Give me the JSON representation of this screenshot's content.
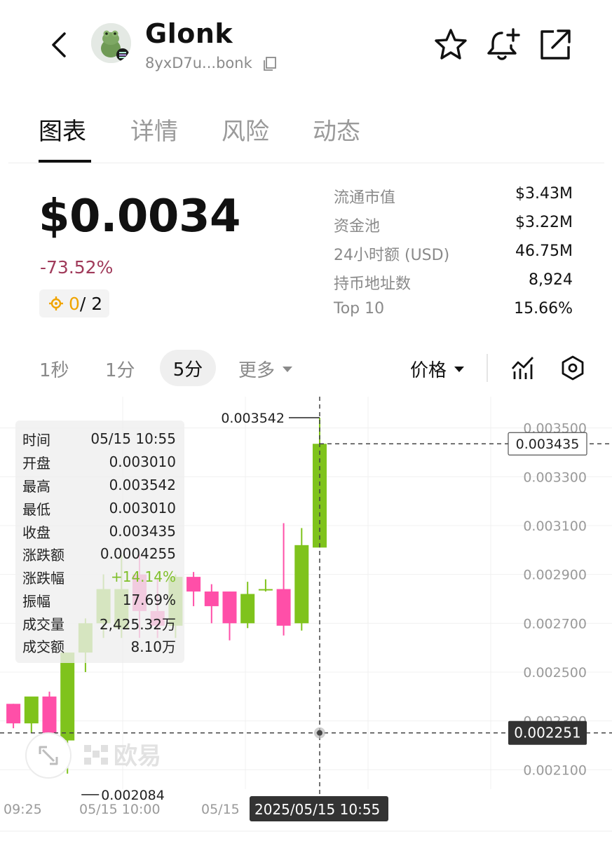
{
  "header": {
    "title": "Glonk",
    "address": "8yxD7u...bonk"
  },
  "tabs": [
    {
      "label": "图表",
      "active": true
    },
    {
      "label": "详情",
      "active": false
    },
    {
      "label": "风险",
      "active": false
    },
    {
      "label": "动态",
      "active": false
    }
  ],
  "price": {
    "value": "$0.0034",
    "change": "-73.52%",
    "score_current": "0",
    "score_rest": " / 2"
  },
  "stats": [
    {
      "label": "流通市值",
      "value": "$3.43M"
    },
    {
      "label": "资金池",
      "value": "$3.22M"
    },
    {
      "label": "24小时额 (USD)",
      "value": "46.75M"
    },
    {
      "label": "持币地址数",
      "value": "8,924"
    },
    {
      "label": "Top 10",
      "value": "15.66%"
    }
  ],
  "intervals": {
    "i1s": "1秒",
    "i1m": "1分",
    "i5m": "5分",
    "more": "更多",
    "price_mode": "价格"
  },
  "colors": {
    "up": "#7fc31c",
    "down": "#ff4fa8",
    "change_negative": "#a03a5a"
  },
  "tooltip": {
    "rows": [
      {
        "label": "时间",
        "value": "05/15 10:55"
      },
      {
        "label": "开盘",
        "value": "0.003010"
      },
      {
        "label": "最高",
        "value": "0.003542"
      },
      {
        "label": "最低",
        "value": "0.003010"
      },
      {
        "label": "收盘",
        "value": "0.003435"
      },
      {
        "label": "涨跌额",
        "value": "0.0004255"
      },
      {
        "label": "涨跌幅",
        "value": "+14.14%"
      },
      {
        "label": "振幅",
        "value": "17.69%"
      },
      {
        "label": "成交量",
        "value": "2,425.32万"
      },
      {
        "label": "成交额",
        "value": "8.10万"
      }
    ]
  },
  "chart_data": {
    "type": "candlestick",
    "y_ticks": [
      0.0021,
      0.0023,
      0.0025,
      0.0027,
      0.0029,
      0.0031,
      0.0033,
      0.0035
    ],
    "y_tick_labels": [
      "0.002100",
      "0.002300",
      "0.002500",
      "0.002700",
      "0.002900",
      "0.003100",
      "0.003300",
      "0.003500"
    ],
    "ylim": [
      0.002035,
      0.003628
    ],
    "x_tick_labels": [
      "09:25",
      "05/15 10:00",
      "05/15"
    ],
    "current_price_label": "0.003435",
    "crosshair_price_label": "0.002251",
    "crosshair_time_label": "2025/05/15 10:55",
    "high_label": "0.003542",
    "low_label": "0.002084",
    "watermark": "欧易",
    "candles": [
      {
        "o": 0.00237,
        "h": 0.00237,
        "l": 0.00227,
        "c": 0.00229
      },
      {
        "o": 0.00229,
        "h": 0.00239,
        "l": 0.00225,
        "c": 0.0024
      },
      {
        "o": 0.0024,
        "h": 0.00242,
        "l": 0.00218,
        "c": 0.00221
      },
      {
        "o": 0.00222,
        "h": 0.00247,
        "l": 0.002084,
        "c": 0.00258
      },
      {
        "o": 0.00258,
        "h": 0.00272,
        "l": 0.0025,
        "c": 0.0027
      },
      {
        "o": 0.0027,
        "h": 0.0029,
        "l": 0.00264,
        "c": 0.00284
      },
      {
        "o": 0.00268,
        "h": 0.00298,
        "l": 0.00264,
        "c": 0.00284
      },
      {
        "o": 0.0029,
        "h": 0.00298,
        "l": 0.00264,
        "c": 0.00275
      },
      {
        "o": 0.00275,
        "h": 0.00288,
        "l": 0.00264,
        "c": 0.00269
      },
      {
        "o": 0.00269,
        "h": 0.0029,
        "l": 0.00264,
        "c": 0.00289
      },
      {
        "o": 0.00289,
        "h": 0.00291,
        "l": 0.00277,
        "c": 0.00283
      },
      {
        "o": 0.00283,
        "h": 0.00286,
        "l": 0.0027,
        "c": 0.00277
      },
      {
        "o": 0.00283,
        "h": 0.00283,
        "l": 0.00263,
        "c": 0.0027
      },
      {
        "o": 0.0027,
        "h": 0.00287,
        "l": 0.00268,
        "c": 0.00282
      },
      {
        "o": 0.00284,
        "h": 0.00288,
        "l": 0.00283,
        "c": 0.00284
      },
      {
        "o": 0.00284,
        "h": 0.00311,
        "l": 0.00265,
        "c": 0.00269
      },
      {
        "o": 0.0027,
        "h": 0.00309,
        "l": 0.00267,
        "c": 0.00302
      },
      {
        "o": 0.00301,
        "h": 0.003542,
        "l": 0.00301,
        "c": 0.003435
      }
    ]
  }
}
